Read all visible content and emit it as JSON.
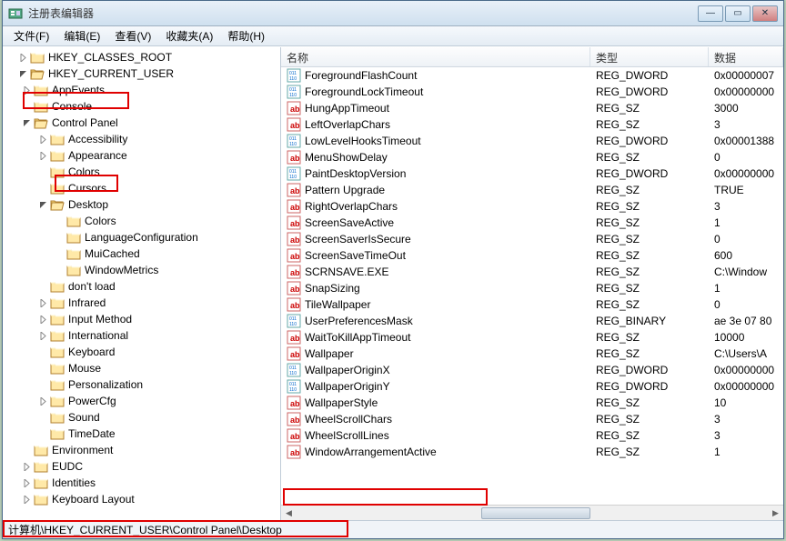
{
  "title": "注册表编辑器",
  "menu": {
    "file": "文件(F)",
    "edit": "编辑(E)",
    "view": "查看(V)",
    "fav": "收藏夹(A)",
    "help": "帮助(H)"
  },
  "list_header": {
    "name": "名称",
    "type": "类型",
    "data": "数据"
  },
  "statusbar": "计算机\\HKEY_CURRENT_USER\\Control Panel\\Desktop",
  "tree": {
    "r0": "HKEY_CLASSES_ROOT",
    "r1": "HKEY_CURRENT_USER",
    "r1_0": "AppEvents",
    "r1_1": "Console",
    "r1_2": "Control Panel",
    "r1_2_0": "Accessibility",
    "r1_2_1": "Appearance",
    "r1_2_2": "Colors",
    "r1_2_3": "Cursors",
    "r1_2_4": "Desktop",
    "r1_2_4_0": "Colors",
    "r1_2_4_1": "LanguageConfiguration",
    "r1_2_4_2": "MuiCached",
    "r1_2_4_3": "WindowMetrics",
    "r1_2_5": "don't load",
    "r1_2_6": "Infrared",
    "r1_2_7": "Input Method",
    "r1_2_8": "International",
    "r1_2_9": "Keyboard",
    "r1_2_10": "Mouse",
    "r1_2_11": "Personalization",
    "r1_2_12": "PowerCfg",
    "r1_2_13": "Sound",
    "r1_2_14": "TimeDate",
    "r1_3": "Environment",
    "r1_4": "EUDC",
    "r1_5": "Identities",
    "r1_6": "Keyboard Layout"
  },
  "values": [
    {
      "icon": "bin",
      "name": "ForegroundFlashCount",
      "type": "REG_DWORD",
      "data": "0x00000007"
    },
    {
      "icon": "bin",
      "name": "ForegroundLockTimeout",
      "type": "REG_DWORD",
      "data": "0x00000000"
    },
    {
      "icon": "str",
      "name": "HungAppTimeout",
      "type": "REG_SZ",
      "data": "3000"
    },
    {
      "icon": "str",
      "name": "LeftOverlapChars",
      "type": "REG_SZ",
      "data": "3"
    },
    {
      "icon": "bin",
      "name": "LowLevelHooksTimeout",
      "type": "REG_DWORD",
      "data": "0x00001388"
    },
    {
      "icon": "str",
      "name": "MenuShowDelay",
      "type": "REG_SZ",
      "data": "0"
    },
    {
      "icon": "bin",
      "name": "PaintDesktopVersion",
      "type": "REG_DWORD",
      "data": "0x00000000"
    },
    {
      "icon": "str",
      "name": "Pattern Upgrade",
      "type": "REG_SZ",
      "data": "TRUE"
    },
    {
      "icon": "str",
      "name": "RightOverlapChars",
      "type": "REG_SZ",
      "data": "3"
    },
    {
      "icon": "str",
      "name": "ScreenSaveActive",
      "type": "REG_SZ",
      "data": "1"
    },
    {
      "icon": "str",
      "name": "ScreenSaverIsSecure",
      "type": "REG_SZ",
      "data": "0"
    },
    {
      "icon": "str",
      "name": "ScreenSaveTimeOut",
      "type": "REG_SZ",
      "data": "600"
    },
    {
      "icon": "str",
      "name": "SCRNSAVE.EXE",
      "type": "REG_SZ",
      "data": "C:\\Window"
    },
    {
      "icon": "str",
      "name": "SnapSizing",
      "type": "REG_SZ",
      "data": "1"
    },
    {
      "icon": "str",
      "name": "TileWallpaper",
      "type": "REG_SZ",
      "data": "0"
    },
    {
      "icon": "bin",
      "name": "UserPreferencesMask",
      "type": "REG_BINARY",
      "data": "ae 3e 07 80"
    },
    {
      "icon": "str",
      "name": "WaitToKillAppTimeout",
      "type": "REG_SZ",
      "data": "10000"
    },
    {
      "icon": "str",
      "name": "Wallpaper",
      "type": "REG_SZ",
      "data": "C:\\Users\\A"
    },
    {
      "icon": "bin",
      "name": "WallpaperOriginX",
      "type": "REG_DWORD",
      "data": "0x00000000"
    },
    {
      "icon": "bin",
      "name": "WallpaperOriginY",
      "type": "REG_DWORD",
      "data": "0x00000000"
    },
    {
      "icon": "str",
      "name": "WallpaperStyle",
      "type": "REG_SZ",
      "data": "10"
    },
    {
      "icon": "str",
      "name": "WheelScrollChars",
      "type": "REG_SZ",
      "data": "3"
    },
    {
      "icon": "str",
      "name": "WheelScrollLines",
      "type": "REG_SZ",
      "data": "3"
    },
    {
      "icon": "str",
      "name": "WindowArrangementActive",
      "type": "REG_SZ",
      "data": "1"
    }
  ]
}
